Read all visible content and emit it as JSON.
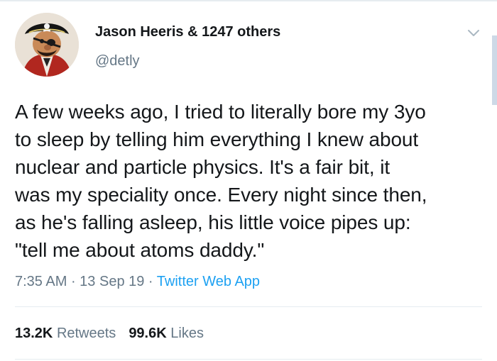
{
  "user": {
    "display_name": "Jason Heeris & 1247 others",
    "handle": "@detly"
  },
  "tweet": {
    "lines": [
      "A few weeks ago, I tried to literally bore my 3yo",
      "to sleep by telling him everything I knew about",
      "nuclear and particle physics. It's a fair bit, it",
      "was my speciality once. Every night since then,",
      "as he's falling asleep, his little voice pipes up:",
      "\"tell me about atoms daddy.\""
    ],
    "time": "7:35 AM",
    "sep1": " · ",
    "date": "13 Sep 19",
    "sep2": " · ",
    "source": "Twitter Web App"
  },
  "stats": {
    "retweets_count": "13.2K",
    "retweets_label": "Retweets",
    "likes_count": "99.6K",
    "likes_label": "Likes"
  },
  "icons": {
    "menu": "chevron-down-icon",
    "avatar": "pirate-puppet-avatar"
  },
  "colors": {
    "text": "#14171a",
    "secondary": "#657786",
    "link": "#1da1f2"
  }
}
